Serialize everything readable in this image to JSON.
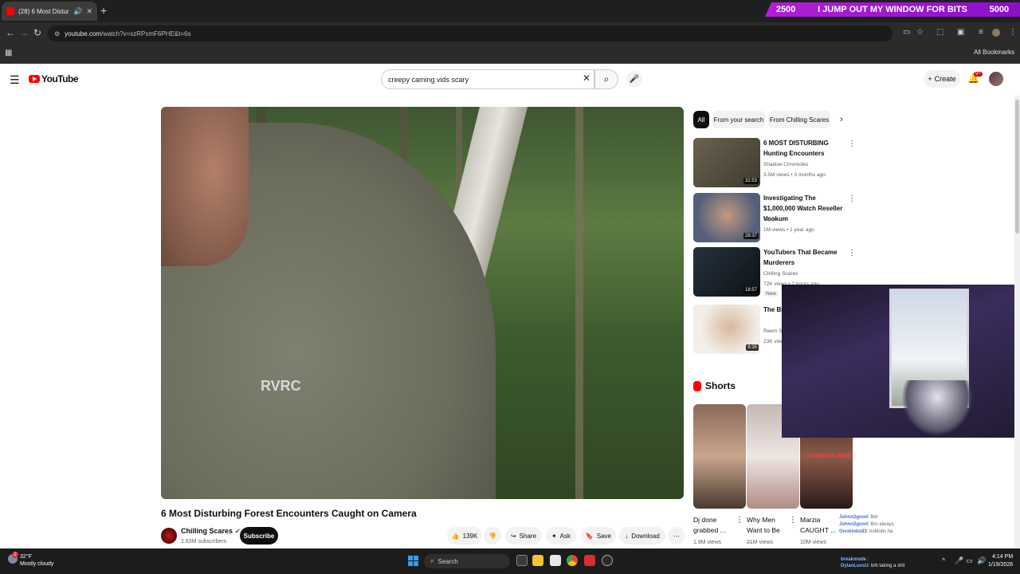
{
  "browser": {
    "tab_title": "(28) 6 Most Disturbing Fore...",
    "url_host": "youtube.com",
    "url_path": "/watch?v=xzRPxmF6PHE&t=6s",
    "bookmarks_all": "All Bookmarks"
  },
  "stream_banner": {
    "left": "2500",
    "middle": "I JUMP OUT MY WINDOW FOR BITS",
    "right": "5000"
  },
  "header": {
    "logo_text": "YouTube",
    "search_value": "creepy caming vids scary",
    "create_label": "Create",
    "notif_count": "9+"
  },
  "video": {
    "title": "6 Most Disturbing Forest Encounters Caught on Camera",
    "channel": "Chilling Scares",
    "subscribers": "2.63M subscribers",
    "subscribe_label": "Subscribe",
    "likes": "139K",
    "share_label": "Share",
    "ask_label": "Ask",
    "save_label": "Save",
    "download_label": "Download",
    "watermark": "RVRC"
  },
  "chips": [
    "All",
    "From your search",
    "From Chilling Scares"
  ],
  "recommended": [
    {
      "title": "6 MOST DISTURBING Hunting Encounters",
      "channel": "Shadow Chronicles",
      "meta": "3.5M views • 3 months ago",
      "duration": "32:53",
      "thumb_color": "#5b5445"
    },
    {
      "title": "Investigating The $1,000,000 Watch Reseller Vookum",
      "channel": "Whoo",
      "meta": "1M views • 1 year ago",
      "duration": "28:37",
      "thumb_color": "#7d6d60"
    },
    {
      "title": "YouTubers That Became Murderers",
      "channel": "Chilling Scares",
      "meta": "72K views • 2 hours ago",
      "badge": "New",
      "duration": "18:57",
      "thumb_color": "#1c2733"
    },
    {
      "title": "The BE... Right N...",
      "channel": "Reem S...",
      "meta": "23K view...",
      "duration": "8:35",
      "thumb_color": "#e8dccb"
    }
  ],
  "shorts_heading": "Shorts",
  "shorts": [
    {
      "title": "Dj done grabbed ...",
      "views": "1.9M views",
      "color": "#a27f6a"
    },
    {
      "title": "Why Men Want to Be ...",
      "views": "21M views",
      "color": "#d8c8c2"
    },
    {
      "title": "Marzia CAUGHT ...",
      "views": "10M views",
      "color": "#6b3b30"
    }
  ],
  "overlay_caption": "I LOVE MY WIFE",
  "chat_ghost": [
    {
      "user": "Johnn2good",
      "msg": "Bet"
    },
    {
      "user": "Johnn2good",
      "msg": "Bro always"
    },
    {
      "user": "Gnoblobs83",
      "msg": "noblobs ha"
    }
  ],
  "chat_live": [
    {
      "user": "breakmode",
      "msg": ":"
    },
    {
      "user": "DylanLuvsU",
      "msg": "brb taking a shit"
    }
  ],
  "taskbar": {
    "weather_temp": "32°F",
    "weather_desc": "Mostly cloudy",
    "weather_badge": "2",
    "search_label": "Search",
    "time": "4:14 PM",
    "date": "1/19/2026"
  }
}
